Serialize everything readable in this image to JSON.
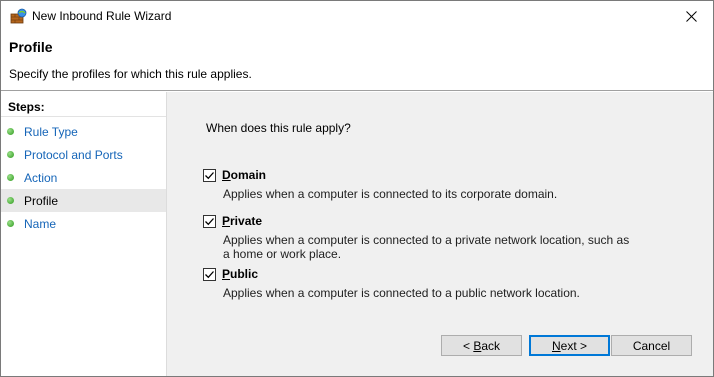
{
  "window": {
    "title": "New Inbound Rule Wizard"
  },
  "header": {
    "title": "Profile",
    "subtitle": "Specify the profiles for which this rule applies."
  },
  "steps": {
    "title": "Steps:",
    "items": [
      {
        "label": "Rule Type",
        "active": false
      },
      {
        "label": "Protocol and Ports",
        "active": false
      },
      {
        "label": "Action",
        "active": false
      },
      {
        "label": "Profile",
        "active": true
      },
      {
        "label": "Name",
        "active": false
      }
    ]
  },
  "main": {
    "question": "When does this rule apply?",
    "options": [
      {
        "label_first": "D",
        "label_rest": "omain",
        "checked": true,
        "desc": "Applies when a computer is connected to its corporate domain."
      },
      {
        "label_first": "P",
        "label_rest": "rivate",
        "checked": true,
        "desc": "Applies when a computer is connected to a private network location, such as a home or work place."
      },
      {
        "label_first": "P",
        "label_rest": "ublic",
        "checked": true,
        "desc": "Applies when a computer is connected to a public network location."
      }
    ]
  },
  "buttons": {
    "back_prefix": "< ",
    "back_mn": "B",
    "back_rest": "ack",
    "next_mn": "N",
    "next_rest": "ext >",
    "cancel": "Cancel"
  },
  "colors": {
    "link": "#1565b8",
    "panel_bg": "#f0f0f0",
    "primary_border": "#0078d7"
  },
  "icons": {
    "app": "firewall-wizard-icon",
    "close": "close-icon",
    "step_bullet": "green-dot-icon",
    "check": "checkmark-icon"
  }
}
